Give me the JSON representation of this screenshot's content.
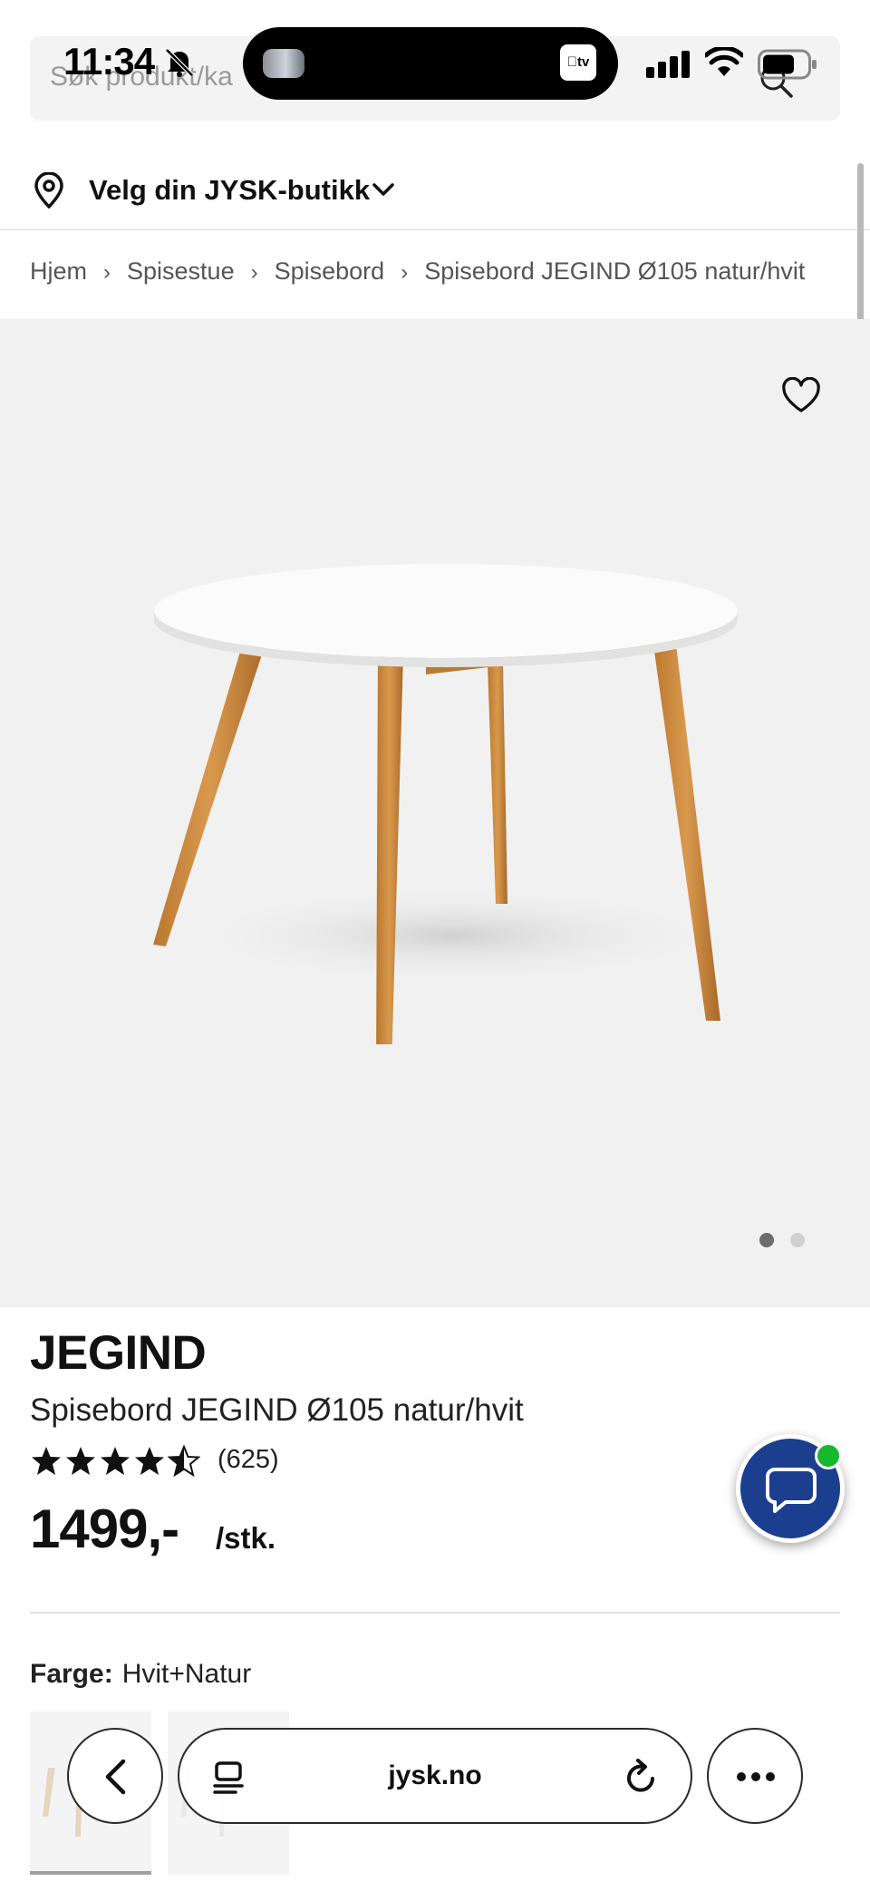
{
  "status_bar": {
    "time": "11:34"
  },
  "search": {
    "placeholder": "Søk produkt/ka"
  },
  "store_selector": {
    "label": "Velg din JYSK-butikk"
  },
  "breadcrumb": [
    "Hjem",
    "Spisestue",
    "Spisebord",
    "Spisebord JEGIND Ø105 natur/hvit"
  ],
  "gallery": {
    "image_count": 2,
    "active_index": 0
  },
  "product": {
    "brand": "JEGIND",
    "name": "Spisebord JEGIND Ø105 natur/hvit",
    "rating": 4.5,
    "review_count": "(625)",
    "price": "1499,-",
    "unit": "/stk.",
    "color_label": "Farge:",
    "color_value": "Hvit+Natur"
  },
  "browser": {
    "url": "jysk.no"
  },
  "colors": {
    "chat_bg": "#1c3e8f",
    "online": "#16b82e",
    "gallery_bg": "#f2f1f1"
  }
}
